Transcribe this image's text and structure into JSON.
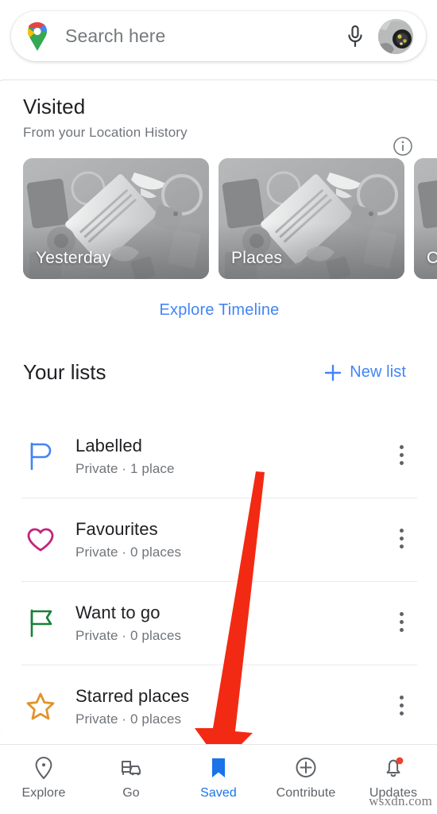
{
  "app": {
    "name": "Google Maps",
    "logo_icon": "google-maps-pin-icon"
  },
  "search": {
    "placeholder": "Search here",
    "value": "",
    "mic_icon": "microphone-icon",
    "avatar_icon": "user-avatar"
  },
  "visited": {
    "title": "Visited",
    "subtitle": "From your Location History",
    "info_icon": "info-icon",
    "cards": [
      {
        "label": "Yesterday"
      },
      {
        "label": "Places"
      },
      {
        "label": "C"
      }
    ],
    "explore_link": "Explore Timeline"
  },
  "lists": {
    "title": "Your lists",
    "new_list_label": "New list",
    "new_list_icon": "plus-icon",
    "items": [
      {
        "name": "Labelled",
        "meta": "Private · 1 place",
        "icon": "flag-rounded-icon",
        "color": "#4285f4",
        "menu_icon": "more-vertical-icon"
      },
      {
        "name": "Favourites",
        "meta": "Private · 0 places",
        "icon": "heart-icon",
        "color": "#c2257a",
        "menu_icon": "more-vertical-icon"
      },
      {
        "name": "Want to go",
        "meta": "Private · 0 places",
        "icon": "flag-icon",
        "color": "#188038",
        "menu_icon": "more-vertical-icon"
      },
      {
        "name": "Starred places",
        "meta": "Private · 0 places",
        "icon": "star-icon",
        "color": "#e0942f",
        "menu_icon": "more-vertical-icon"
      }
    ]
  },
  "annotation": {
    "arrow_color": "#f32a13",
    "points_to": "Saved"
  },
  "bottomnav": {
    "items": [
      {
        "label": "Explore",
        "icon": "location-pin-icon",
        "active": false
      },
      {
        "label": "Go",
        "icon": "commute-icon",
        "active": false
      },
      {
        "label": "Saved",
        "icon": "bookmark-icon",
        "active": true
      },
      {
        "label": "Contribute",
        "icon": "plus-circle-icon",
        "active": false
      },
      {
        "label": "Updates",
        "icon": "bell-icon",
        "active": false,
        "badge": true
      }
    ],
    "active_color": "#1a73e8",
    "inactive_color": "#5f6368",
    "badge_color": "#ea4335"
  },
  "watermark": {
    "text": "wsxdn.com"
  }
}
